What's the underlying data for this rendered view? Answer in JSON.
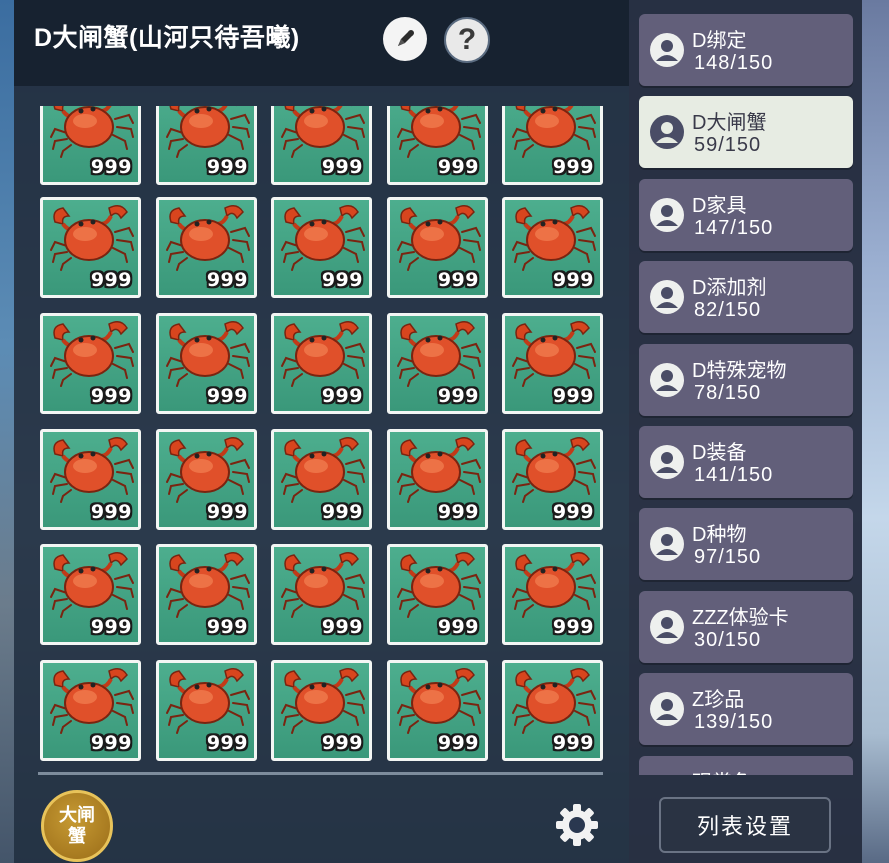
{
  "header": {
    "title": "D大闸蟹(山河只待吾曦)",
    "edit_icon": "pencil-icon",
    "help_label": "?"
  },
  "inventory": {
    "item_icon": "crab-icon",
    "rows": 6,
    "cols": 5,
    "quantities": [
      "999",
      "999",
      "999",
      "999",
      "999",
      "999",
      "999",
      "999",
      "999",
      "999",
      "999",
      "999",
      "999",
      "999",
      "999",
      "999",
      "999",
      "999",
      "999",
      "999",
      "999",
      "999",
      "999",
      "999",
      "999",
      "999",
      "999",
      "999",
      "999",
      "999"
    ]
  },
  "footer": {
    "badge_label": "大闸蟹",
    "settings_icon": "gear-icon"
  },
  "sidebar": {
    "items": [
      {
        "name": "D绑定",
        "count": "148/150",
        "active": false
      },
      {
        "name": "D大闸蟹",
        "count": "59/150",
        "active": true
      },
      {
        "name": "D家具",
        "count": "147/150",
        "active": false
      },
      {
        "name": "D添加剂",
        "count": "82/150",
        "active": false
      },
      {
        "name": "D特殊宠物",
        "count": "78/150",
        "active": false
      },
      {
        "name": "D装备",
        "count": "141/150",
        "active": false
      },
      {
        "name": "D种物",
        "count": "97/150",
        "active": false
      },
      {
        "name": "ZZZ体验卡",
        "count": "30/150",
        "active": false
      },
      {
        "name": "Z珍品",
        "count": "139/150",
        "active": false
      },
      {
        "name": "观赏鱼",
        "count": "",
        "active": false
      }
    ],
    "list_settings_label": "列表设置"
  },
  "colors": {
    "cell_green": "#4dae8e",
    "active_item": "#e7ece3",
    "inactive_item": "#625f7a",
    "badge_gold": "#c69a33"
  }
}
